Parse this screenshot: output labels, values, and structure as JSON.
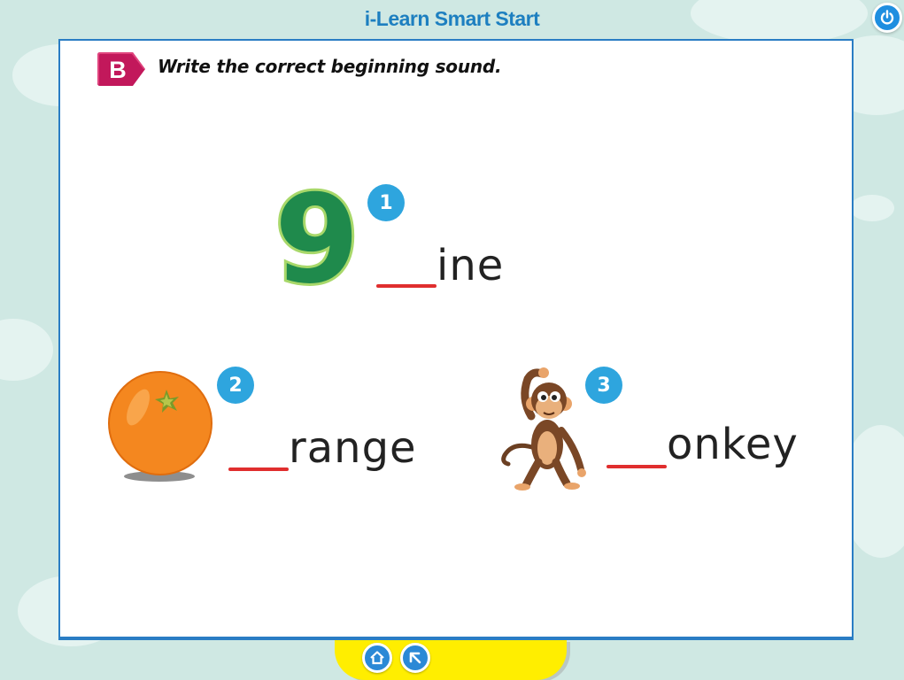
{
  "app": {
    "title": "i-Learn Smart Start"
  },
  "exercise": {
    "section_letter": "B",
    "instruction": "Write the correct beginning sound.",
    "items": [
      {
        "number": "1",
        "picture": "number-nine-image",
        "word_ending": "ine",
        "digit": "9"
      },
      {
        "number": "2",
        "picture": "orange-image",
        "word_ending": "range"
      },
      {
        "number": "3",
        "picture": "monkey-image",
        "word_ending": "onkey"
      }
    ]
  },
  "footer": {
    "buttons": [
      "home-icon",
      "back-arrow-icon"
    ]
  },
  "colors": {
    "title_blue": "#1d7fc0",
    "badge_magenta": "#c2185b",
    "number_badge": "#2ea5de",
    "blank_line": "#e02e2e",
    "footer_yellow": "#ffee00",
    "panel_border": "#2a7dc4"
  }
}
